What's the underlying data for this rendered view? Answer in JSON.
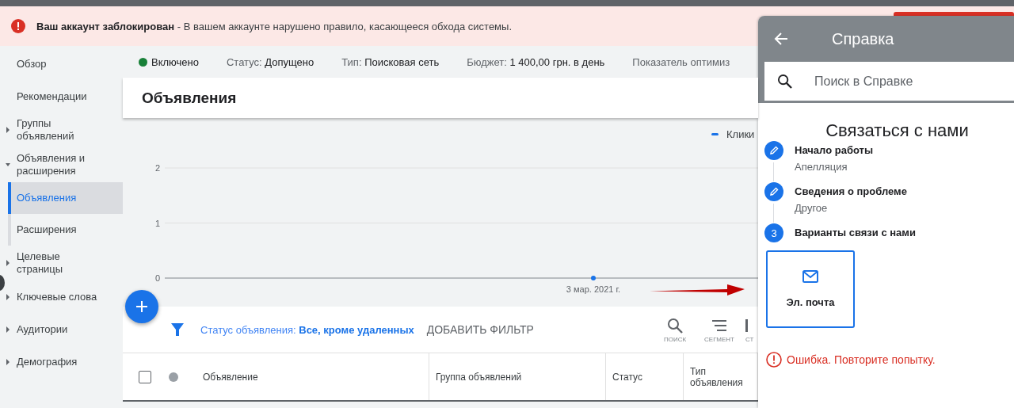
{
  "alert_banner": {
    "text": "**Ваш аккаунт заблокирован** - В вашем аккаунте нарушено правило, касающееся обхода системы."
  },
  "sidebar": {
    "items": [
      {
        "label": "Обзор",
        "selected": false
      },
      {
        "label": "Рекомендации",
        "selected": false
      },
      {
        "label": "Группы объявлений",
        "selected": false,
        "expanded": false
      },
      {
        "label": "Объявления и расширения",
        "selected": false,
        "expanded": true,
        "children": [
          {
            "label": "Объявления",
            "selected": true
          },
          {
            "label": "Расширения",
            "selected": false
          }
        ]
      },
      {
        "label": "Целевые страницы",
        "selected": false,
        "expanded": false
      },
      {
        "label": "Ключевые слова",
        "selected": false,
        "expanded": false
      },
      {
        "label": "Аудитории",
        "selected": false,
        "expanded": false
      },
      {
        "label": "Демография",
        "selected": false,
        "expanded": false
      }
    ]
  },
  "status_bar": {
    "state": "Включено",
    "enabled": true,
    "fields": [
      {
        "label": "Статус:",
        "value": "Допущено"
      },
      {
        "label": "Тип:",
        "value": "Поисковая сеть"
      },
      {
        "label": "Бюджет:",
        "value": "1 400,00 грн. в день"
      },
      {
        "label": "Показатель оптимиз"
      }
    ]
  },
  "page_title": "Объявления",
  "chart": {
    "chart_data": {
      "type": "line",
      "categories": [
        "3 мар. 2021 г."
      ],
      "series": [
        {
          "name": "Клики",
          "color": "#1a73e8",
          "marker": "circle",
          "values": [
            0
          ]
        }
      ],
      "ylim": [
        0,
        2
      ],
      "yticks": [
        0,
        1,
        2
      ]
    }
  },
  "filter_bar": {
    "filter": "Статус объявления: **Все, кроме удаленных**",
    "add_filter": "ДОБАВИТЬ ФИЛЬТР",
    "tools": [
      {
        "kind": "search",
        "label": "ПОИСК"
      },
      {
        "kind": "segment",
        "label": "СЕГМЕНТ"
      },
      {
        "kind": "columns",
        "label": "СТ"
      }
    ]
  },
  "table": {
    "select_all_checked": false,
    "columns": [
      "Объявление",
      "Группа объявлений",
      "Статус",
      "Тип объявления"
    ]
  },
  "help_panel": {
    "title": "Справка",
    "search": {
      "placeholder": "Поиск в Справке"
    },
    "heading": "Связаться с нами",
    "steps": [
      {
        "kind": "done",
        "title": "Начало работы",
        "value": "Апелляция"
      },
      {
        "kind": "done",
        "title": "Сведения о проблеме",
        "value": "Другое"
      },
      {
        "kind": "current",
        "number": "3",
        "title": "Варианты связи с нами"
      }
    ],
    "options": [
      {
        "kind": "email",
        "label": "Эл. почта"
      }
    ],
    "error": "Ошибка. Повторите попытку."
  }
}
